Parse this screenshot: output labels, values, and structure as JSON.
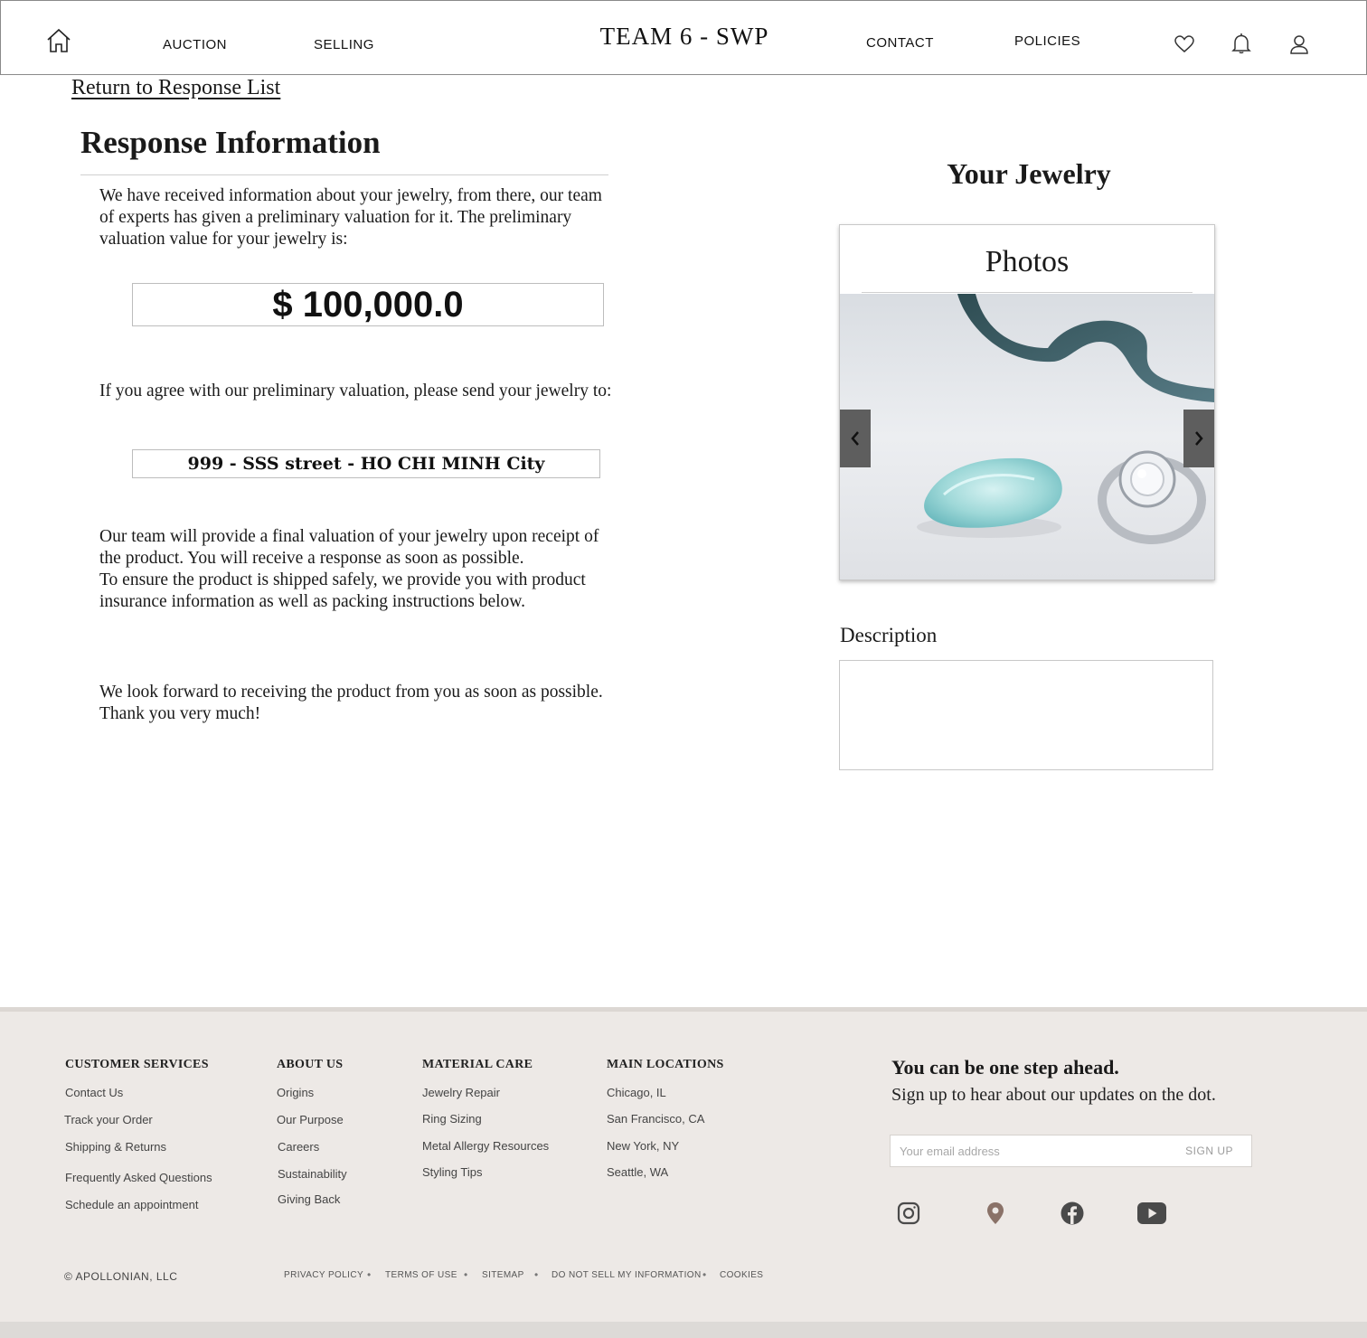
{
  "header": {
    "nav_left": [
      "AUCTION",
      "SELLING"
    ],
    "brand": "TEAM 6 - SWP",
    "nav_right": [
      "CONTACT",
      "POLICIES"
    ],
    "icons": [
      "home-icon",
      "heart-icon",
      "bell-icon",
      "user-icon"
    ]
  },
  "main": {
    "return_link": "Return to Response List",
    "title": "Response Information",
    "intro": "We have received information about your jewelry, from there, our team of experts has given a preliminary valuation for it. The preliminary valuation value for your jewelry is:",
    "valuation": "$ 100,000.0",
    "agree_text": "If you agree with our preliminary valuation, please send your jewelry to:",
    "address": "999 - SSS street - HO CHI MINH City",
    "final_text_1": "Our team will provide a final valuation of your jewelry upon receipt of the product. You will receive a response as soon as possible.",
    "final_text_2": "To ensure the product is shipped safely, we provide you with product insurance information as well as packing instructions below.",
    "closing": "We look forward to receiving the product from you as soon as possible. Thank you very much!"
  },
  "jewelry": {
    "title": "Your Jewelry",
    "photos_title": "Photos",
    "description_label": "Description",
    "description_value": ""
  },
  "footer": {
    "columns": [
      {
        "heading": "CUSTOMER SERVICES",
        "links": [
          "Contact Us",
          "Track your Order",
          "Shipping & Returns",
          "Frequently Asked Questions",
          "Schedule an appointment"
        ]
      },
      {
        "heading": "ABOUT US",
        "links": [
          "Origins",
          "Our Purpose",
          "Careers",
          "Sustainability",
          "Giving Back"
        ]
      },
      {
        "heading": "MATERIAL CARE",
        "links": [
          "Jewelry Repair",
          "Ring Sizing",
          "Metal Allergy Resources",
          "Styling Tips"
        ]
      },
      {
        "heading": "MAIN LOCATIONS",
        "links": [
          "Chicago, IL",
          "San Francisco, CA",
          "New York, NY",
          "Seattle, WA"
        ]
      }
    ],
    "signup_title": "You can be one step ahead.",
    "signup_subtitle": "Sign up to hear about our updates on the dot.",
    "email_placeholder": "Your email address",
    "signup_button": "SIGN UP",
    "social_icons": [
      "instagram-icon",
      "location-pin-icon",
      "facebook-icon",
      "youtube-icon"
    ],
    "copyright": "©  APOLLONIAN, LLC",
    "legal_links": [
      "PRIVACY POLICY",
      "TERMS OF USE",
      "SITEMAP",
      "DO NOT SELL MY INFORMATION",
      "COOKIES"
    ],
    "separator": "•"
  },
  "colors": {
    "footer_bg": "#ede9e6",
    "location_pin": "#8a7268",
    "carousel_button": "#5e5e5e"
  }
}
